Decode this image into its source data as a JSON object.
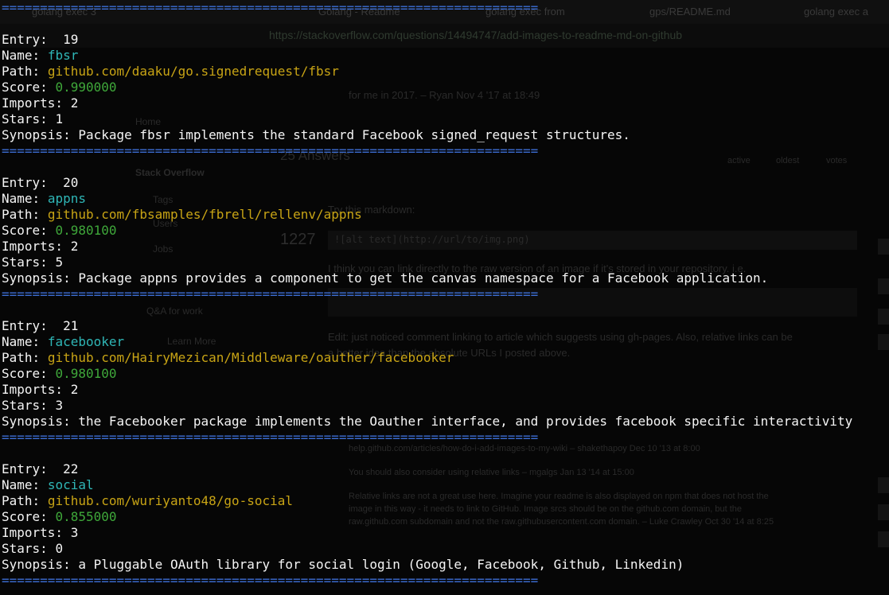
{
  "background_browser": {
    "tabs": [
      "golang exec 3",
      "Golang - Readme",
      "golang exec from",
      "gps/README.md",
      "golang exec a"
    ],
    "url": "https://stackoverflow.com/questions/14494747/add-images-to-readme-md-on-github",
    "sidebar": {
      "home": "Home",
      "stack_overflow": "Stack Overflow",
      "tags": "Tags",
      "users": "Users",
      "jobs": "Jobs",
      "qa_for_work": "Q&A for work",
      "learn_more": "Learn More"
    },
    "answers_heading": "25 Answers",
    "sort_tabs": [
      "active",
      "oldest",
      "votes"
    ],
    "vote_count": "1227",
    "lines": {
      "comment_top": "for me in 2017. – Ryan Nov 4 '17 at 18:49",
      "try_markdown": "Try this markdown:",
      "code": "![alt text](http://url/to/img.png)",
      "explain": "I think you can link directly to the raw version of an image if it's stored in your repository. i.e.",
      "edit": "Edit: just noticed comment linking to article which suggests using gh-pages. Also, relative links can be",
      "edit2": "a better idea than the absolute URLs I posted above.",
      "comment1": "help.github.com/articles/how-do-i-add-images-to-my-wiki – shakethapoy Dec 10 '13 at 8:00",
      "comment2": "You should also consider using relative links – mgalgs Jan 13 '14 at 15:00",
      "comment3": "Relative links are not a great use here. Imagine your readme is also displayed on npm that does not host the",
      "comment4": "image in this way - it needs to link to GitHub. Image srcs should be on the github.com domain, but the",
      "comment5": "raw.github.com subdomain and not the raw.githubusercontent.com domain. – Luke Crawley Oct 30 '14 at 8:25"
    }
  },
  "terminal": {
    "separator": "======================================================================",
    "labels": {
      "entry": "Entry:",
      "name": "Name:",
      "path": "Path:",
      "score": "Score:",
      "imports": "Imports:",
      "stars": "Stars:",
      "synopsis": "Synopsis:"
    },
    "entries": [
      {
        "entry": " 19",
        "name": "fbsr",
        "path": "github.com/daaku/go.signedrequest/fbsr",
        "score": "0.990000",
        "imports": "2",
        "stars": "1",
        "synopsis": "Package fbsr implements the standard Facebook signed_request structures."
      },
      {
        "entry": " 20",
        "name": "appns",
        "path": "github.com/fbsamples/fbrell/rellenv/appns",
        "score": "0.980100",
        "imports": "2",
        "stars": "5",
        "synopsis": "Package appns provides a component to get the canvas namespace for a Facebook application."
      },
      {
        "entry": " 21",
        "name": "facebooker",
        "path": "github.com/HairyMezican/Middleware/oauther/facebooker",
        "score": "0.980100",
        "imports": "2",
        "stars": "3",
        "synopsis": "the Facebooker package implements the Oauther interface, and provides facebook specific interactivity"
      },
      {
        "entry": " 22",
        "name": "social",
        "path": "github.com/wuriyanto48/go-social",
        "score": "0.855000",
        "imports": "3",
        "stars": "0",
        "synopsis": "a Pluggable OAuth library for social login (Google, Facebook, Github, Linkedin)"
      }
    ]
  },
  "colors": {
    "separator": "#3d6fd6",
    "name": "#2fb6b6",
    "path": "#c8a415",
    "score": "#3fa83a",
    "text": "#f5f5f5",
    "background": "#060606"
  }
}
